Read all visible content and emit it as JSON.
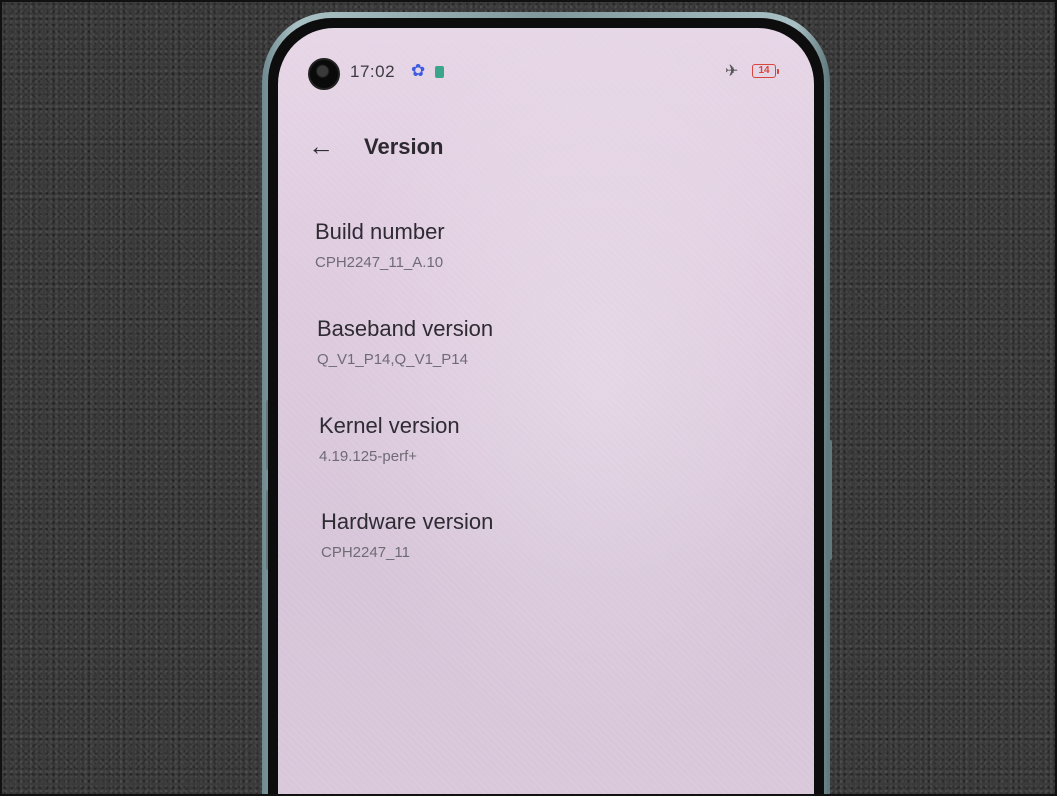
{
  "status_bar": {
    "time": "17:02",
    "battery": "14",
    "icons": [
      "gear-icon",
      "sim-icon",
      "airplane-icon",
      "battery-icon"
    ]
  },
  "header": {
    "back_icon": "arrow-left-icon",
    "title": "Version"
  },
  "items": [
    {
      "label": "Build number",
      "value": "CPH2247_11_A.10"
    },
    {
      "label": "Baseband version",
      "value": "Q_V1_P14,Q_V1_P14"
    },
    {
      "label": "Kernel version",
      "value": "4.19.125-perf+"
    },
    {
      "label": "Hardware version",
      "value": "CPH2247_11"
    }
  ],
  "colors": {
    "screen_background": "#decbde",
    "accent_gear": "#3f5be0",
    "battery_low": "#d6463c",
    "phone_frame": "#8aa4a8"
  }
}
